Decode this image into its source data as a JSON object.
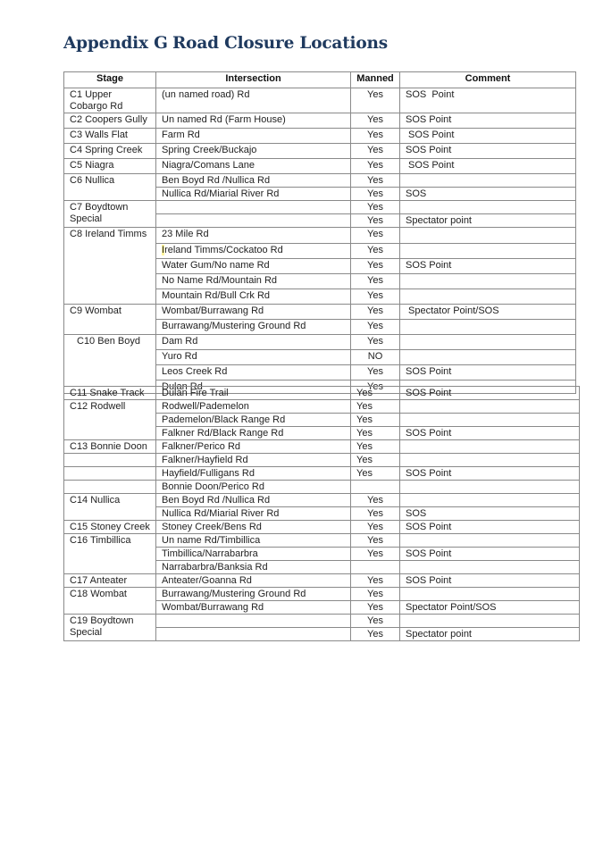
{
  "title": {
    "appendix": "Appendix G",
    "heading": "Road Closure Locations"
  },
  "table": {
    "headers": [
      "Stage",
      "Intersection",
      "Manned",
      "Comment"
    ],
    "stages": [
      {
        "stage": "C1 Upper Cobargo Rd",
        "rows": [
          {
            "intersection": "(un named road) Rd",
            "manned": "Yes",
            "comment": "SOS  Point"
          }
        ]
      },
      {
        "stage": "C2 Coopers Gully",
        "rows": [
          {
            "intersection": "Un named Rd (Farm House)",
            "manned": "Yes",
            "comment": "SOS Point"
          }
        ]
      },
      {
        "stage": "C3 Walls Flat",
        "rows": [
          {
            "intersection": "Farm Rd",
            "manned": "Yes",
            "comment": " SOS Point"
          }
        ]
      },
      {
        "stage": "C4 Spring Creek",
        "rows": [
          {
            "intersection": "Spring Creek/Buckajo",
            "manned": "Yes",
            "comment": "SOS Point"
          }
        ]
      },
      {
        "stage": "C5 Niagra",
        "rows": [
          {
            "intersection": "Niagra/Comans Lane",
            "manned": "Yes",
            "comment": " SOS Point"
          }
        ]
      },
      {
        "stage": "C6 Nullica",
        "rows": [
          {
            "intersection": "Ben Boyd Rd /Nullica Rd",
            "manned": "Yes",
            "comment": ""
          },
          {
            "intersection": "Nullica Rd/Miarial River Rd",
            "manned": "Yes",
            "comment": "SOS"
          }
        ]
      },
      {
        "stage": "C7 Boydtown Special",
        "rows": [
          {
            "intersection": "",
            "manned": "Yes",
            "comment": ""
          },
          {
            "intersection": "",
            "manned": "Yes",
            "comment": "Spectator point"
          }
        ]
      },
      {
        "stage": "C8 Ireland Timms",
        "rows": [
          {
            "intersection": "23 Mile Rd",
            "manned": "Yes",
            "comment": ""
          },
          {
            "intersection": "Ireland Timms/Cockatoo Rd",
            "manned": "Yes",
            "comment": ""
          },
          {
            "intersection": "Water Gum/No name Rd",
            "manned": "Yes",
            "comment": "SOS Point"
          },
          {
            "intersection": "No Name Rd/Mountain Rd",
            "manned": "Yes",
            "comment": ""
          },
          {
            "intersection": "Mountain Rd/Bull Crk Rd",
            "manned": "Yes",
            "comment": ""
          }
        ]
      },
      {
        "stage": "C9 Wombat",
        "rows": [
          {
            "intersection": "Wombat/Burrawang Rd",
            "manned": "Yes",
            "comment": " Spectator Point/SOS"
          },
          {
            "intersection": "Burrawang/Mustering Ground Rd",
            "manned": "Yes",
            "comment": ""
          }
        ]
      },
      {
        "stage": "C10 Ben Boyd",
        "rows": [
          {
            "intersection": "Dam Rd",
            "manned": "Yes",
            "comment": ""
          },
          {
            "intersection": "Yuro Rd",
            "manned": "NO",
            "comment": ""
          },
          {
            "intersection": "Leos Creek Rd",
            "manned": "Yes",
            "comment": "SOS Point"
          },
          {
            "intersection": "Dulan Rd",
            "manned": "Yes",
            "comment": ""
          }
        ]
      },
      {
        "stage": "C11 Snake Track",
        "rows": [
          {
            "intersection": "Dulan Fire Trail",
            "manned": "Yes",
            "comment": "SOS Point"
          }
        ]
      },
      {
        "stage": "C12 Rodwell",
        "rows": [
          {
            "intersection": "Rodwell/Pademelon",
            "manned": "Yes",
            "comment": ""
          },
          {
            "intersection": "Pademelon/Black Range Rd",
            "manned": "Yes",
            "comment": ""
          },
          {
            "intersection": "Falkner Rd/Black Range Rd",
            "manned": "Yes",
            "comment": "SOS Point"
          }
        ]
      },
      {
        "stage": "C13 Bonnie Doon",
        "rows": [
          {
            "intersection": "Falkner/Perico Rd",
            "manned": "Yes",
            "comment": ""
          },
          {
            "intersection": "Falkner/Hayfield Rd",
            "manned": "Yes",
            "comment": ""
          },
          {
            "intersection": "Hayfield/Fulligans Rd",
            "manned": "Yes",
            "comment": "SOS Point"
          },
          {
            "intersection": "Bonnie Doon/Perico Rd",
            "manned": "",
            "comment": ""
          }
        ]
      },
      {
        "stage": "C14 Nullica",
        "rows": [
          {
            "intersection": "Ben Boyd Rd /Nullica Rd",
            "manned": "Yes",
            "comment": ""
          },
          {
            "intersection": "Nullica Rd/Miarial River Rd",
            "manned": "Yes",
            "comment": "SOS"
          }
        ]
      },
      {
        "stage": "C15 Stoney Creek",
        "rows": [
          {
            "intersection": "Stoney Creek/Bens Rd",
            "manned": "Yes",
            "comment": "SOS Point"
          }
        ]
      },
      {
        "stage": "C16 Timbillica",
        "rows": [
          {
            "intersection": "Un name Rd/Timbillica",
            "manned": "Yes",
            "comment": ""
          },
          {
            "intersection": "Timbillica/Narrabarbra",
            "manned": "Yes",
            "comment": "SOS Point"
          },
          {
            "intersection": "Narrabarbra/Banksia Rd",
            "manned": "",
            "comment": ""
          }
        ]
      },
      {
        "stage": "C17 Anteater",
        "rows": [
          {
            "intersection": "Anteater/Goanna Rd",
            "manned": "Yes",
            "comment": "SOS Point"
          }
        ]
      },
      {
        "stage": "C18 Wombat",
        "rows": [
          {
            "intersection": "Burrawang/Mustering Ground Rd",
            "manned": "Yes",
            "comment": ""
          },
          {
            "intersection": "Wombat/Burrawang Rd",
            "manned": "Yes",
            "comment": "Spectator Point/SOS"
          }
        ]
      },
      {
        "stage": "C19 Boydtown Special",
        "rows": [
          {
            "intersection": "",
            "manned": "Yes",
            "comment": ""
          },
          {
            "intersection": "",
            "manned": "Yes",
            "comment": "Spectator point"
          }
        ]
      }
    ]
  }
}
